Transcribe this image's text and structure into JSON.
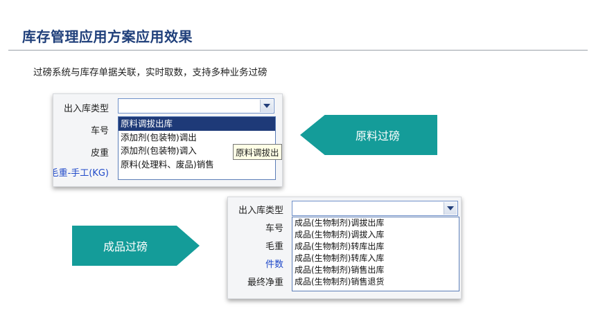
{
  "slide": {
    "title": "库存管理应用方案应用效果",
    "subtitle": "过磅系统与库存单据关联，实时取数，支持多种业务过磅"
  },
  "shot1": {
    "labels": [
      "出入库类型",
      "车号",
      "皮重",
      "毛重-手工(KG)"
    ],
    "combo_value": "",
    "options": [
      "原料调拔出库",
      "添加剂(包装物)调出",
      "添加剂(包装物)调入",
      "原料(处理料、废品)销售"
    ],
    "tooltip": "原料调拔出"
  },
  "shot2": {
    "labels": [
      "出入库类型",
      "车号",
      "毛重",
      "件数",
      "最终净重"
    ],
    "combo_value": "",
    "options": [
      "成品(生物制剂)调拔出库",
      "成品(生物制剂)调拔入库",
      "成品(生物制剂)转库出库",
      "成品(生物制剂)转库入库",
      "成品(生物制剂)销售出库",
      "成品(生物制剂)销售退货"
    ]
  },
  "callouts": {
    "raw": "原料过磅",
    "finished": "成品过磅"
  },
  "colors": {
    "accent": "#149c99",
    "title": "#1f3f7a",
    "selection": "#1e3a78"
  }
}
